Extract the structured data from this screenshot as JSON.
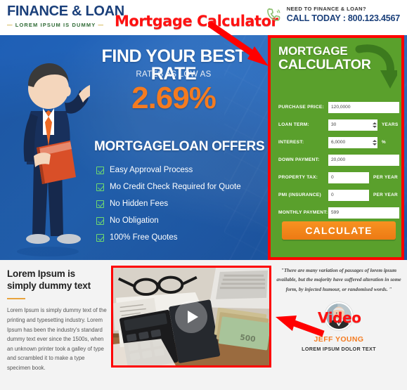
{
  "header": {
    "brand_title": "FINANCE & LOAN",
    "brand_subtitle": "LOREM IPSUM IS DUMMY",
    "contact_line1": "NEED TO FINANCE & LOAN?",
    "contact_line2": "CALL TODAY : 800.123.4567",
    "phone_icon": "phone-icon"
  },
  "annotations": {
    "calculator_label": "Mortgage Calculator",
    "video_label": "Video",
    "arrow_color": "#ff0000"
  },
  "hero": {
    "headline": "FIND YOUR BEST RATE",
    "subhead": "RATES AS LOW AS",
    "rate": "2.69%",
    "offers_title": "MORTGAGELOAN OFFERS",
    "offers": [
      "Easy Approval Process",
      "Mo Credit Check Required for Quote",
      "No Hidden Fees",
      "No Obligation",
      "100% Free Quotes"
    ],
    "background_color": "#2468bd",
    "accent_color": "#f47b20"
  },
  "calculator": {
    "title_line1": "MORTGAGE",
    "title_line2": "CALCULATOR",
    "panel_color": "#5aa02c",
    "border_color": "#ff0000",
    "fields": [
      {
        "label": "PURCHASE PRICE:",
        "value": "120,0000",
        "suffix": "",
        "spinner": false,
        "width": "full"
      },
      {
        "label": "LOAN TERM:",
        "value": "30",
        "suffix": "YEARS",
        "spinner": true,
        "width": "spin"
      },
      {
        "label": "INTEREST:",
        "value": "6,0000",
        "suffix": "%",
        "spinner": true,
        "width": "spin"
      },
      {
        "label": "DOWN PAYMENT:",
        "value": "20,000",
        "suffix": "",
        "spinner": false,
        "width": "full"
      },
      {
        "label": "PROPERTY TAX:",
        "value": "0",
        "suffix": "PER YEAR",
        "spinner": false,
        "width": "half"
      },
      {
        "label": "PMI (INSURANCE)",
        "value": "0",
        "suffix": "PER YEAR",
        "spinner": false,
        "width": "half"
      },
      {
        "label": "MONTHLY PAYMENT:",
        "value": "599",
        "suffix": "",
        "spinner": false,
        "width": "full"
      }
    ],
    "submit_label": "CALCULATE",
    "submit_color": "#f47b20"
  },
  "bottom": {
    "text_heading": "Lorem Ipsum is simply dummy text",
    "text_body": "Lorem Ipsum is simply dummy text of the printing and typesetting industry. Lorem Ipsum has been the industry's standard dummy text ever since the 1500s, when an unknown printer took a galley of type and scrambled it to make a type specimen book.",
    "video_play_icon": "play-icon",
    "testimonial_quote": "\"There are many variation of passages of lorem ipsum available, but the majority have suffered alteration in some form, by injected humour, or randomised words. \"",
    "testimonial_name": "JEFF YOUNG",
    "testimonial_role": "LOREM IPSUM DOLOR TEXT"
  }
}
